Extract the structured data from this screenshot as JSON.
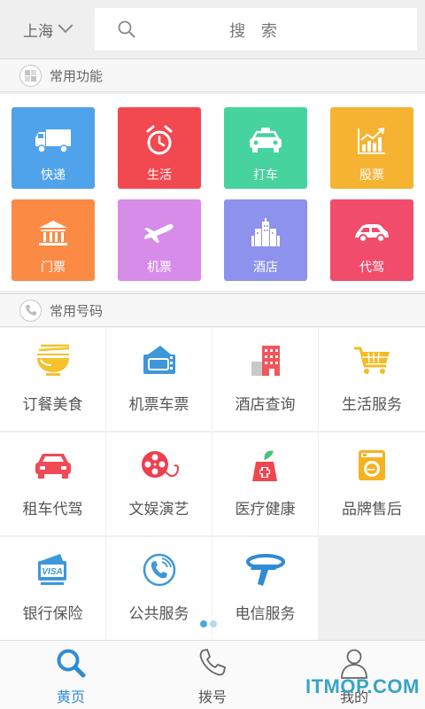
{
  "header": {
    "city": "上海",
    "search_placeholder": "搜 索"
  },
  "sections": {
    "common_functions": "常用功能",
    "common_numbers": "常用号码"
  },
  "functions": [
    {
      "label": "快递",
      "icon": "delivery-truck-icon",
      "color": "#4fa3ea"
    },
    {
      "label": "生活",
      "icon": "alarm-clock-icon",
      "color": "#f2484f"
    },
    {
      "label": "打车",
      "icon": "taxi-icon",
      "color": "#46d39d"
    },
    {
      "label": "股票",
      "icon": "stock-chart-icon",
      "color": "#f5b331"
    },
    {
      "label": "门票",
      "icon": "museum-icon",
      "color": "#fb8a44"
    },
    {
      "label": "机票",
      "icon": "airplane-icon",
      "color": "#d68ce8"
    },
    {
      "label": "酒店",
      "icon": "hotel-building-icon",
      "color": "#8d92ec"
    },
    {
      "label": "代驾",
      "icon": "car-icon",
      "color": "#f14c6b"
    }
  ],
  "numbers": [
    {
      "label": "订餐美食",
      "icon": "noodle-bowl-icon",
      "color": "#f6c12a"
    },
    {
      "label": "机票车票",
      "icon": "ticket-icon",
      "color": "#3e97d9"
    },
    {
      "label": "酒店查询",
      "icon": "hotel-icon",
      "color": "#f0565c"
    },
    {
      "label": "生活服务",
      "icon": "shopping-cart-icon",
      "color": "#f6bb20"
    },
    {
      "label": "租车代驾",
      "icon": "car-rental-icon",
      "color": "#f04a56"
    },
    {
      "label": "文娱演艺",
      "icon": "film-reel-icon",
      "color": "#ee3f4f"
    },
    {
      "label": "医疗健康",
      "icon": "medicine-icon",
      "color": "#f0474e"
    },
    {
      "label": "品牌售后",
      "icon": "washing-machine-icon",
      "color": "#f6b21e"
    },
    {
      "label": "银行保险",
      "icon": "bank-card-icon",
      "color": "#3e97d9"
    },
    {
      "label": "公共服务",
      "icon": "phone-circle-icon",
      "color": "#3e97d9"
    },
    {
      "label": "电信服务",
      "icon": "telecom-logo-icon",
      "color": "#2f8bd6"
    }
  ],
  "nav": [
    {
      "label": "黄页",
      "icon": "search-icon"
    },
    {
      "label": "拨号",
      "icon": "phone-icon"
    },
    {
      "label": "我的",
      "icon": "user-icon"
    }
  ],
  "watermark": "ITMOP.COM",
  "accent": "#2f8bd6"
}
